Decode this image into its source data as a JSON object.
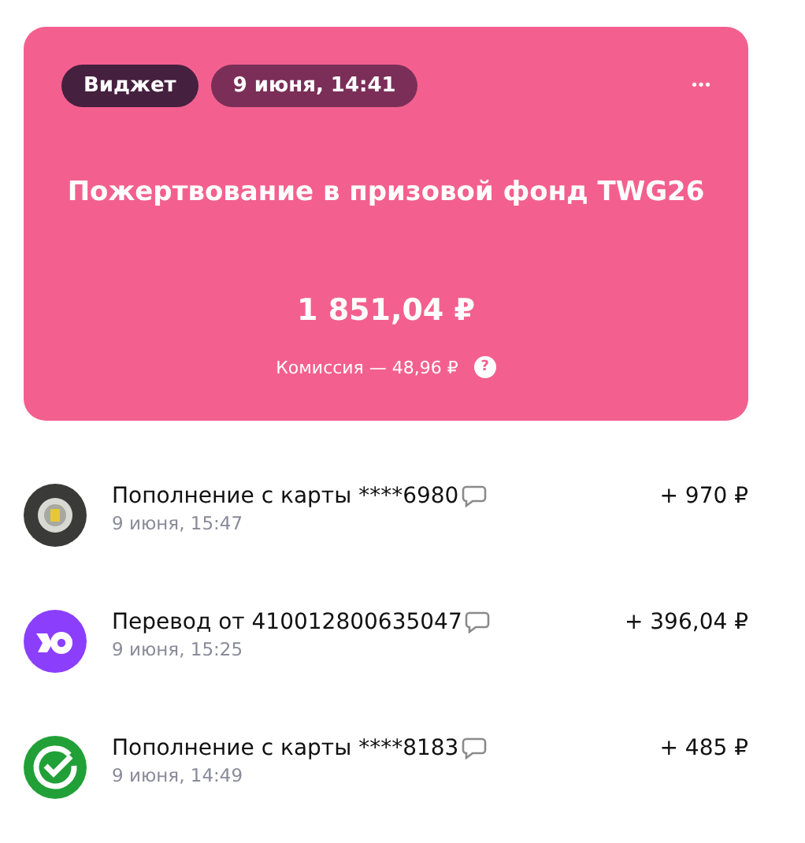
{
  "card": {
    "tags": [
      {
        "label": "Виджет",
        "kind": "dark"
      },
      {
        "label": "9 июня, 14:41",
        "kind": "muted"
      }
    ],
    "menu": "•••",
    "title": "Пожертвование в призовой фонд TWG26",
    "amount": "1 851,04 ₽",
    "commission": "Комиссия — 48,96 ₽",
    "help": "?"
  },
  "operations": [
    {
      "kind": "emblem",
      "title": "Пополнение с карты ****6980",
      "time": "9 июня, 15:47",
      "amount": "+ 970 ₽"
    },
    {
      "kind": "wallet",
      "title": "Перевод от 410012800635047",
      "time": "9 июня, 15:25",
      "amount": "+ 396,04 ₽"
    },
    {
      "kind": "check",
      "title": "Пополнение с карты ****8183",
      "time": "9 июня, 14:49",
      "amount": "+ 485 ₽"
    }
  ]
}
